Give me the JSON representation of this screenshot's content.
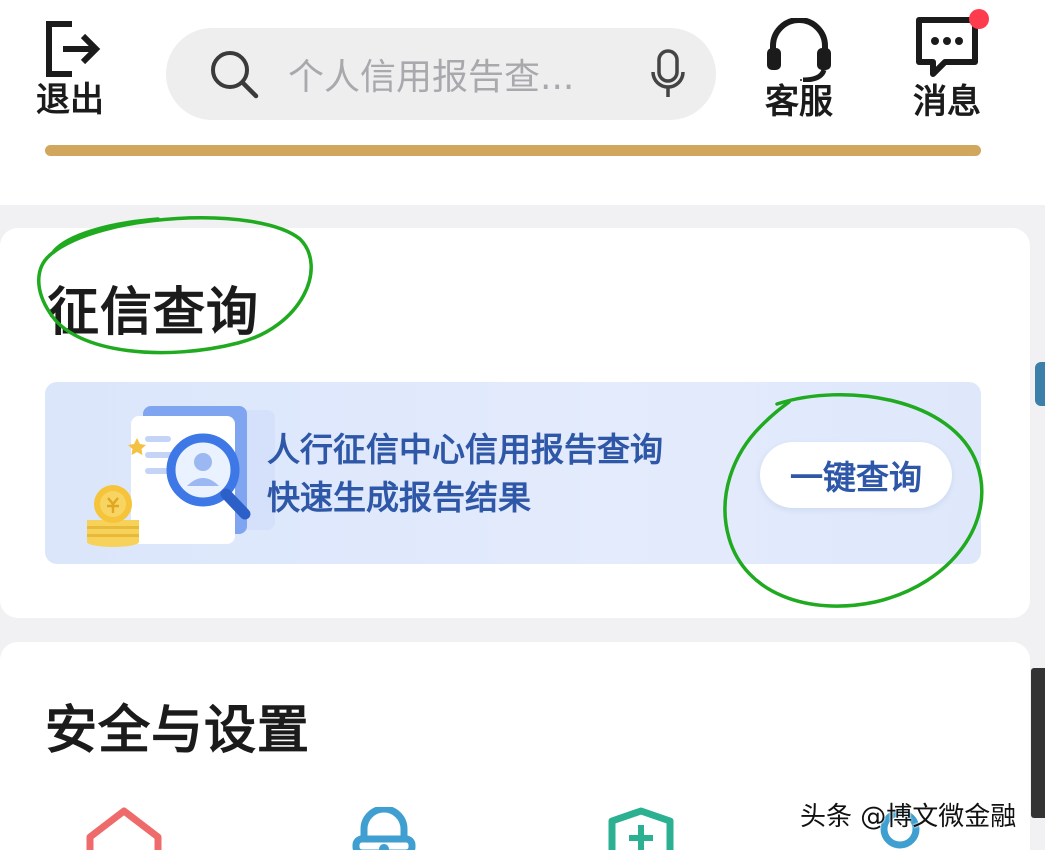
{
  "header": {
    "exit_label": "退出",
    "search_placeholder": "个人信用报告查...",
    "service_label": "客服",
    "message_label": "消息",
    "message_badge_color": "#ff3b4e",
    "divider_color": "#d0a75c",
    "icons": {
      "exit": "exit-icon",
      "search": "search-icon",
      "mic": "microphone-icon",
      "service": "headset-icon",
      "message": "chat-bubble-icon"
    }
  },
  "credit_section": {
    "title": "征信查询",
    "banner": {
      "line1": "人行征信中心信用报告查询",
      "line2": "快速生成报告结果",
      "button_label": "一键查询",
      "text_color": "#2f57a8",
      "icon": "credit-report-magnifier-icon"
    }
  },
  "security_section": {
    "title": "安全与设置",
    "icons": [
      "home-icon",
      "lock-icon",
      "shield-plus-icon",
      "user-icon"
    ],
    "icon_colors": [
      "#ef6b6b",
      "#3f9fd0",
      "#2bb091",
      "#3f9fd0"
    ]
  },
  "annotations": {
    "color": "#1faa1f"
  },
  "watermark": "头条 @博文微金融"
}
